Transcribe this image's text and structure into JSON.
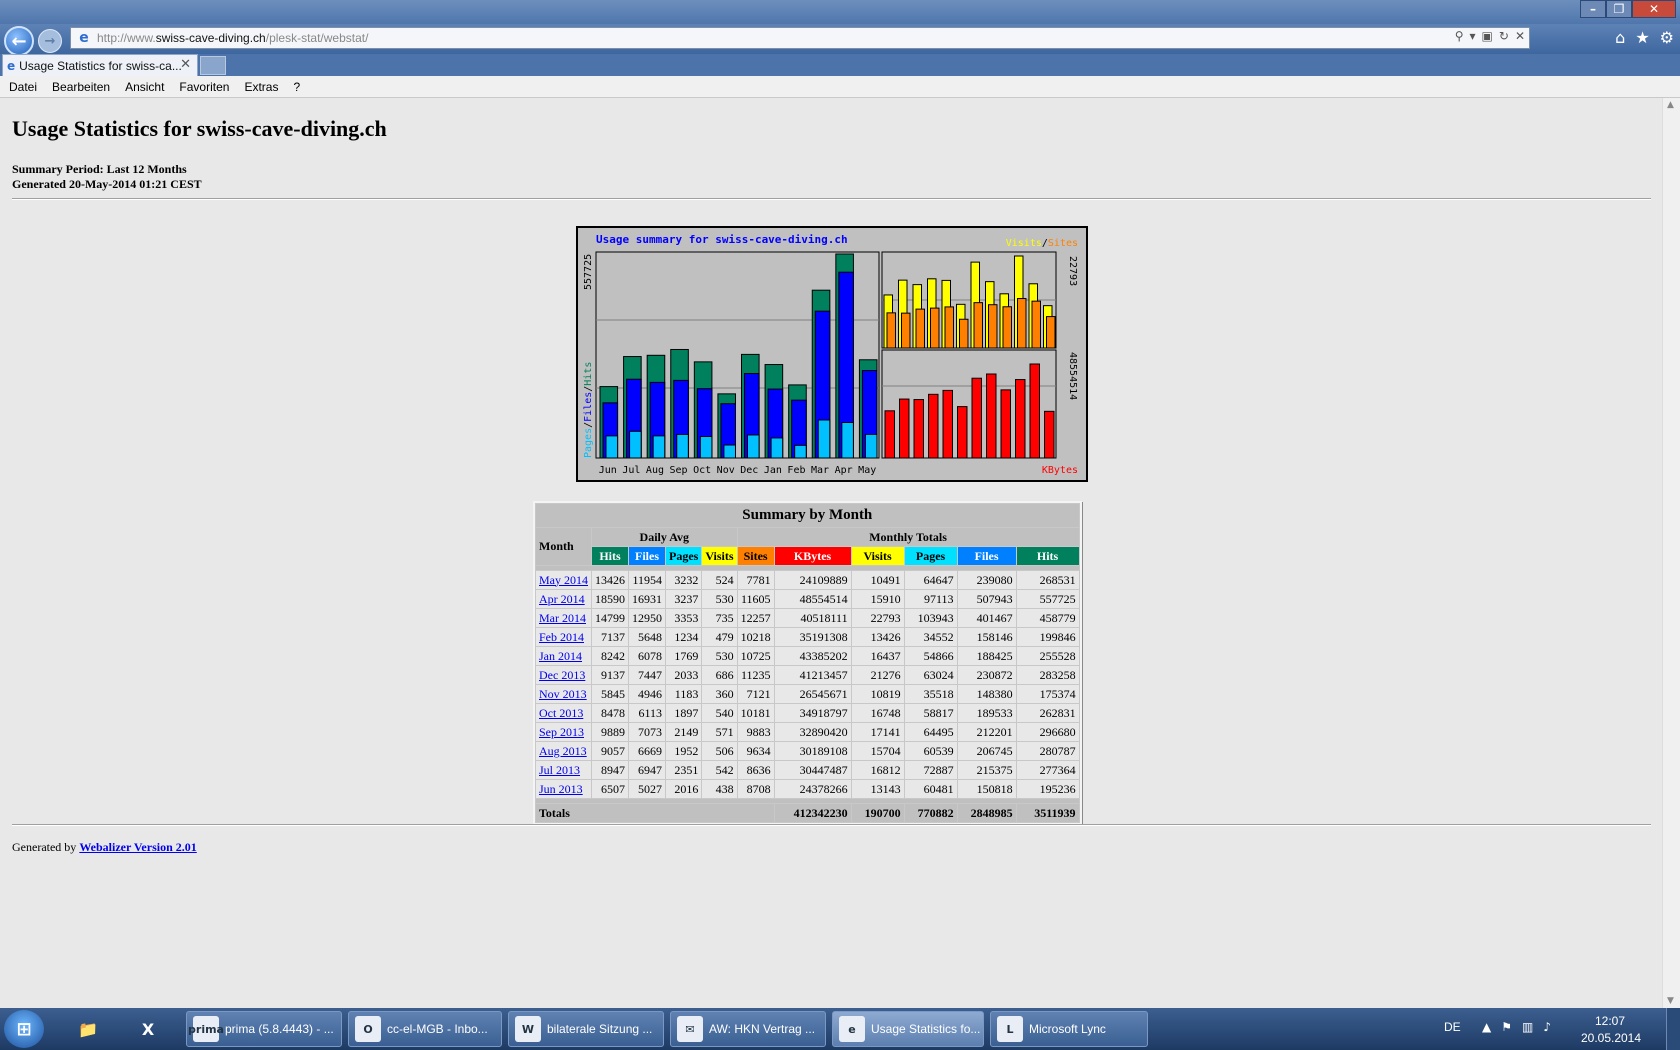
{
  "browser": {
    "address_prefix": "http://www.",
    "address_host": "swiss-cave-diving.ch",
    "address_path": "/plesk-stat/webstat/",
    "tab_title": "Usage Statistics for swiss-ca...",
    "menu": [
      "Datei",
      "Bearbeiten",
      "Ansicht",
      "Favoriten",
      "Extras",
      "?"
    ]
  },
  "page": {
    "title": "Usage Statistics for swiss-cave-diving.ch",
    "summary_period": "Summary Period: Last 12 Months",
    "generated": "Generated 20-May-2014 01:21 CEST",
    "footer_prefix": "Generated by ",
    "footer_link": "Webalizer Version 2.01"
  },
  "chart_data": {
    "type": "bar",
    "title": "Usage summary for swiss-cave-diving.ch",
    "categories": [
      "Jun",
      "Jul",
      "Aug",
      "Sep",
      "Oct",
      "Nov",
      "Dec",
      "Jan",
      "Feb",
      "Mar",
      "Apr",
      "May"
    ],
    "left_panel": {
      "max_label": "557725",
      "axis_label_parts": [
        "Pages",
        "/",
        "Files",
        "/",
        "Hits"
      ],
      "series": [
        {
          "name": "Hits",
          "color": "#00805c",
          "values": [
            195236,
            277364,
            280787,
            296680,
            262831,
            175374,
            283258,
            255528,
            199846,
            458779,
            557725,
            268531
          ]
        },
        {
          "name": "Files",
          "color": "#0000ff",
          "values": [
            150818,
            215375,
            206745,
            212201,
            189533,
            148380,
            230872,
            188425,
            158146,
            401467,
            507943,
            239080
          ]
        },
        {
          "name": "Pages",
          "color": "#00c0ff",
          "values": [
            60481,
            72887,
            60539,
            64495,
            58817,
            35518,
            63024,
            54866,
            34552,
            103943,
            97113,
            64647
          ]
        }
      ]
    },
    "top_right_panel": {
      "max_label": "22793",
      "legend_parts": [
        "Visits",
        "/",
        "Sites"
      ],
      "series": [
        {
          "name": "Visits",
          "color": "#ffff00",
          "values": [
            13143,
            16812,
            15704,
            17141,
            16748,
            10819,
            21276,
            16437,
            13426,
            22793,
            15910,
            10491
          ]
        },
        {
          "name": "Sites",
          "color": "#ff8000",
          "values": [
            8708,
            8636,
            9634,
            9883,
            10181,
            7121,
            11235,
            10725,
            10218,
            12257,
            11605,
            7781
          ]
        }
      ]
    },
    "bottom_right_panel": {
      "max_label": "48554514",
      "legend": "KBytes",
      "series": [
        {
          "name": "KBytes",
          "color": "#ff0000",
          "values": [
            24378266,
            30447487,
            30189108,
            32890420,
            34918797,
            26545671,
            41213457,
            43385202,
            35191308,
            40518111,
            48554514,
            24109889
          ]
        }
      ]
    }
  },
  "table": {
    "caption": "Summary by Month",
    "month_header": "Month",
    "daily_avg_header": "Daily Avg",
    "monthly_totals_header": "Monthly Totals",
    "daily_cols": [
      "Hits",
      "Files",
      "Pages",
      "Visits"
    ],
    "monthly_cols": [
      "Sites",
      "KBytes",
      "Visits",
      "Pages",
      "Files",
      "Hits"
    ],
    "rows": [
      [
        "May 2014",
        "13426",
        "11954",
        "3232",
        "524",
        "7781",
        "24109889",
        "10491",
        "64647",
        "239080",
        "268531"
      ],
      [
        "Apr 2014",
        "18590",
        "16931",
        "3237",
        "530",
        "11605",
        "48554514",
        "15910",
        "97113",
        "507943",
        "557725"
      ],
      [
        "Mar 2014",
        "14799",
        "12950",
        "3353",
        "735",
        "12257",
        "40518111",
        "22793",
        "103943",
        "401467",
        "458779"
      ],
      [
        "Feb 2014",
        "7137",
        "5648",
        "1234",
        "479",
        "10218",
        "35191308",
        "13426",
        "34552",
        "158146",
        "199846"
      ],
      [
        "Jan 2014",
        "8242",
        "6078",
        "1769",
        "530",
        "10725",
        "43385202",
        "16437",
        "54866",
        "188425",
        "255528"
      ],
      [
        "Dec 2013",
        "9137",
        "7447",
        "2033",
        "686",
        "11235",
        "41213457",
        "21276",
        "63024",
        "230872",
        "283258"
      ],
      [
        "Nov 2013",
        "5845",
        "4946",
        "1183",
        "360",
        "7121",
        "26545671",
        "10819",
        "35518",
        "148380",
        "175374"
      ],
      [
        "Oct 2013",
        "8478",
        "6113",
        "1897",
        "540",
        "10181",
        "34918797",
        "16748",
        "58817",
        "189533",
        "262831"
      ],
      [
        "Sep 2013",
        "9889",
        "7073",
        "2149",
        "571",
        "9883",
        "32890420",
        "17141",
        "64495",
        "212201",
        "296680"
      ],
      [
        "Aug 2013",
        "9057",
        "6669",
        "1952",
        "506",
        "9634",
        "30189108",
        "15704",
        "60539",
        "206745",
        "280787"
      ],
      [
        "Jul 2013",
        "8947",
        "6947",
        "2351",
        "542",
        "8636",
        "30447487",
        "16812",
        "72887",
        "215375",
        "277364"
      ],
      [
        "Jun 2013",
        "6507",
        "5027",
        "2016",
        "438",
        "8708",
        "24378266",
        "13143",
        "60481",
        "150818",
        "195236"
      ]
    ],
    "totals_label": "Totals",
    "totals": {
      "kbytes": "412342230",
      "visits": "190700",
      "pages": "770882",
      "files": "2848985",
      "hits": "3511939"
    }
  },
  "taskbar": {
    "tasks": [
      {
        "label": "prima (5.8.4443) - ...",
        "icon": "prima"
      },
      {
        "label": "cc-el-MGB - Inbo...",
        "icon": "O"
      },
      {
        "label": "bilaterale Sitzung ...",
        "icon": "W"
      },
      {
        "label": "AW: HKN Vertrag ...",
        "icon": "✉"
      },
      {
        "label": "Usage Statistics fo...",
        "icon": "e"
      },
      {
        "label": "Microsoft Lync",
        "icon": "L"
      }
    ],
    "lang": "DE",
    "time": "12:07",
    "date": "20.05.2014"
  }
}
